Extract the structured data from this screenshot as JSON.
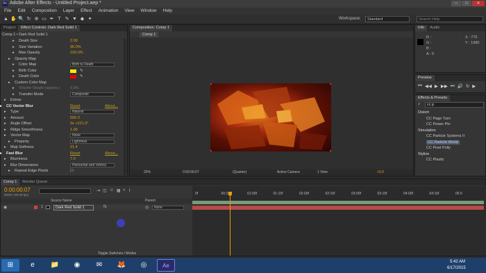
{
  "window": {
    "title": "Adobe After Effects - Untitled Project.aep *",
    "buttons": [
      "–",
      "□",
      "✕"
    ]
  },
  "menu": [
    "File",
    "Edit",
    "Composition",
    "Layer",
    "Effect",
    "Animation",
    "View",
    "Window",
    "Help"
  ],
  "toolbar": {
    "tools": [
      "▲",
      "✋",
      "🔍",
      "↻",
      "⊕",
      "▭",
      "✒",
      "T",
      "✎",
      "▼",
      "◆",
      "✦"
    ],
    "workspace_label": "Workspace:",
    "workspace_value": "Standard",
    "search_placeholder": "Search Help"
  },
  "left_panel": {
    "tabs": [
      "Project",
      "Effect Controls: Dark Red Solid 1"
    ],
    "header": "Comp 1 • Dark Red Solid 1",
    "rows": [
      {
        "label": "Death Size",
        "value": "2.00",
        "indent": 22
      },
      {
        "label": "Size Variation",
        "value": "96.0%",
        "indent": 22
      },
      {
        "label": "Max Opacity",
        "value": "100.0%",
        "indent": 22
      },
      {
        "label": "Opacity Map",
        "value": "",
        "indent": 16
      },
      {
        "label": "Color Map",
        "value": "",
        "indent": 22,
        "select": "Birth to Death"
      },
      {
        "label": "Birth Color",
        "value": "",
        "indent": 22,
        "swatch": "#ffee00"
      },
      {
        "label": "Death Color",
        "value": "",
        "indent": 22,
        "swatch": "#ee0000"
      },
      {
        "label": "Custom Color Map",
        "value": "",
        "indent": 16
      },
      {
        "label": "Volume Shade (approx.)",
        "value": "0.0%",
        "indent": 22,
        "dim": true
      },
      {
        "label": "Transfer Mode",
        "value": "",
        "indent": 22,
        "select": "Composite"
      },
      {
        "label": "Extras",
        "value": "",
        "indent": 10
      },
      {
        "label": "CC Vector Blur",
        "value": "",
        "indent": 4,
        "header": true,
        "reset": "Reset",
        "about": "About..."
      },
      {
        "label": "Type",
        "value": "",
        "indent": 10,
        "select": "Natural"
      },
      {
        "label": "Amount",
        "value": "500.0",
        "indent": 10
      },
      {
        "label": "Angle Offset",
        "value": "0x +221.0°",
        "indent": 10
      },
      {
        "label": "Ridge Smoothness",
        "value": "1.00",
        "indent": 10
      },
      {
        "label": "Vector Map",
        "value": "",
        "indent": 10,
        "select": "None"
      },
      {
        "label": "Property",
        "value": "",
        "indent": 16,
        "select": "Lightness"
      },
      {
        "label": "Map Softness",
        "value": "21.4",
        "indent": 10
      },
      {
        "label": "Fast Blur",
        "value": "",
        "indent": 4,
        "header": true,
        "reset": "Reset",
        "about": "About..."
      },
      {
        "label": "Blurriness",
        "value": "7.0",
        "indent": 10
      },
      {
        "label": "Blur Dimensions",
        "value": "",
        "indent": 10,
        "select": "Horizontal and Vertica"
      },
      {
        "label": "Repeat Edge Pixels",
        "value": "",
        "indent": 16,
        "checkbox": true
      }
    ]
  },
  "comp_panel": {
    "tab": "Composition: Comp 1",
    "subtab": "Comp 1",
    "bottom": {
      "zoom": "25%",
      "timecode": "0:00:00:07",
      "resolution": "(Quarter)",
      "camera": "Active Camera",
      "views": "1 View",
      "exposure": "+0.0"
    }
  },
  "info_panel": {
    "tabs": [
      "Info",
      "Audio"
    ],
    "R": "R :",
    "G": "G :",
    "B": "B :",
    "A": "A : 0",
    "X": "X : 776",
    "Y": "Y : 1080"
  },
  "preview_panel": {
    "tab": "Preview",
    "controls": [
      "⏮",
      "◀◀",
      "▶",
      "▶▶",
      "⏭",
      "🔊",
      "↻",
      "▶"
    ]
  },
  "effects_panel": {
    "tab": "Effects & Presets",
    "search_value": "cc p",
    "tree": [
      {
        "label": "Distort",
        "level": 0
      },
      {
        "label": "CC Page Turn",
        "level": 1
      },
      {
        "label": "CC Power Pin",
        "level": 1
      },
      {
        "label": "Simulation",
        "level": 0
      },
      {
        "label": "CC Particle Systems II",
        "level": 1
      },
      {
        "label": "CC Particle World",
        "level": 1,
        "selected": true
      },
      {
        "label": "CC Pixel Polly",
        "level": 1
      },
      {
        "label": "Stylize",
        "level": 0
      },
      {
        "label": "CC Plastic",
        "level": 1
      }
    ]
  },
  "timeline": {
    "tabs": [
      "Comp 1",
      "Render Queue"
    ],
    "timecode": "0:00:00:07",
    "subtime": "00007 (30.00 fps)",
    "search_placeholder": "",
    "col_source": "Source Name",
    "col_parent": "Parent",
    "layer_num": "1",
    "layer_name": "Dark Red Solid 1",
    "parent_value": "None",
    "ruler": [
      "0f",
      "00:15f",
      "01:00f",
      "01:15f",
      "02:00f",
      "02:15f",
      "03:00f",
      "03:15f",
      "04:00f",
      "04:15f",
      "05:0"
    ],
    "toggle_label": "Toggle Switches / Modes"
  },
  "taskbar": {
    "apps": [
      "⊞",
      "e",
      "📁",
      "◉",
      "✉",
      "🦊",
      "◎",
      "Ae"
    ],
    "time": "5:42 AM",
    "date": "6/17/2015"
  },
  "colors": {
    "accent": "#e0a010",
    "playhead": "#e8a000",
    "layer_bar": "#b84a4a",
    "taskbar": "#1e3f6a"
  }
}
